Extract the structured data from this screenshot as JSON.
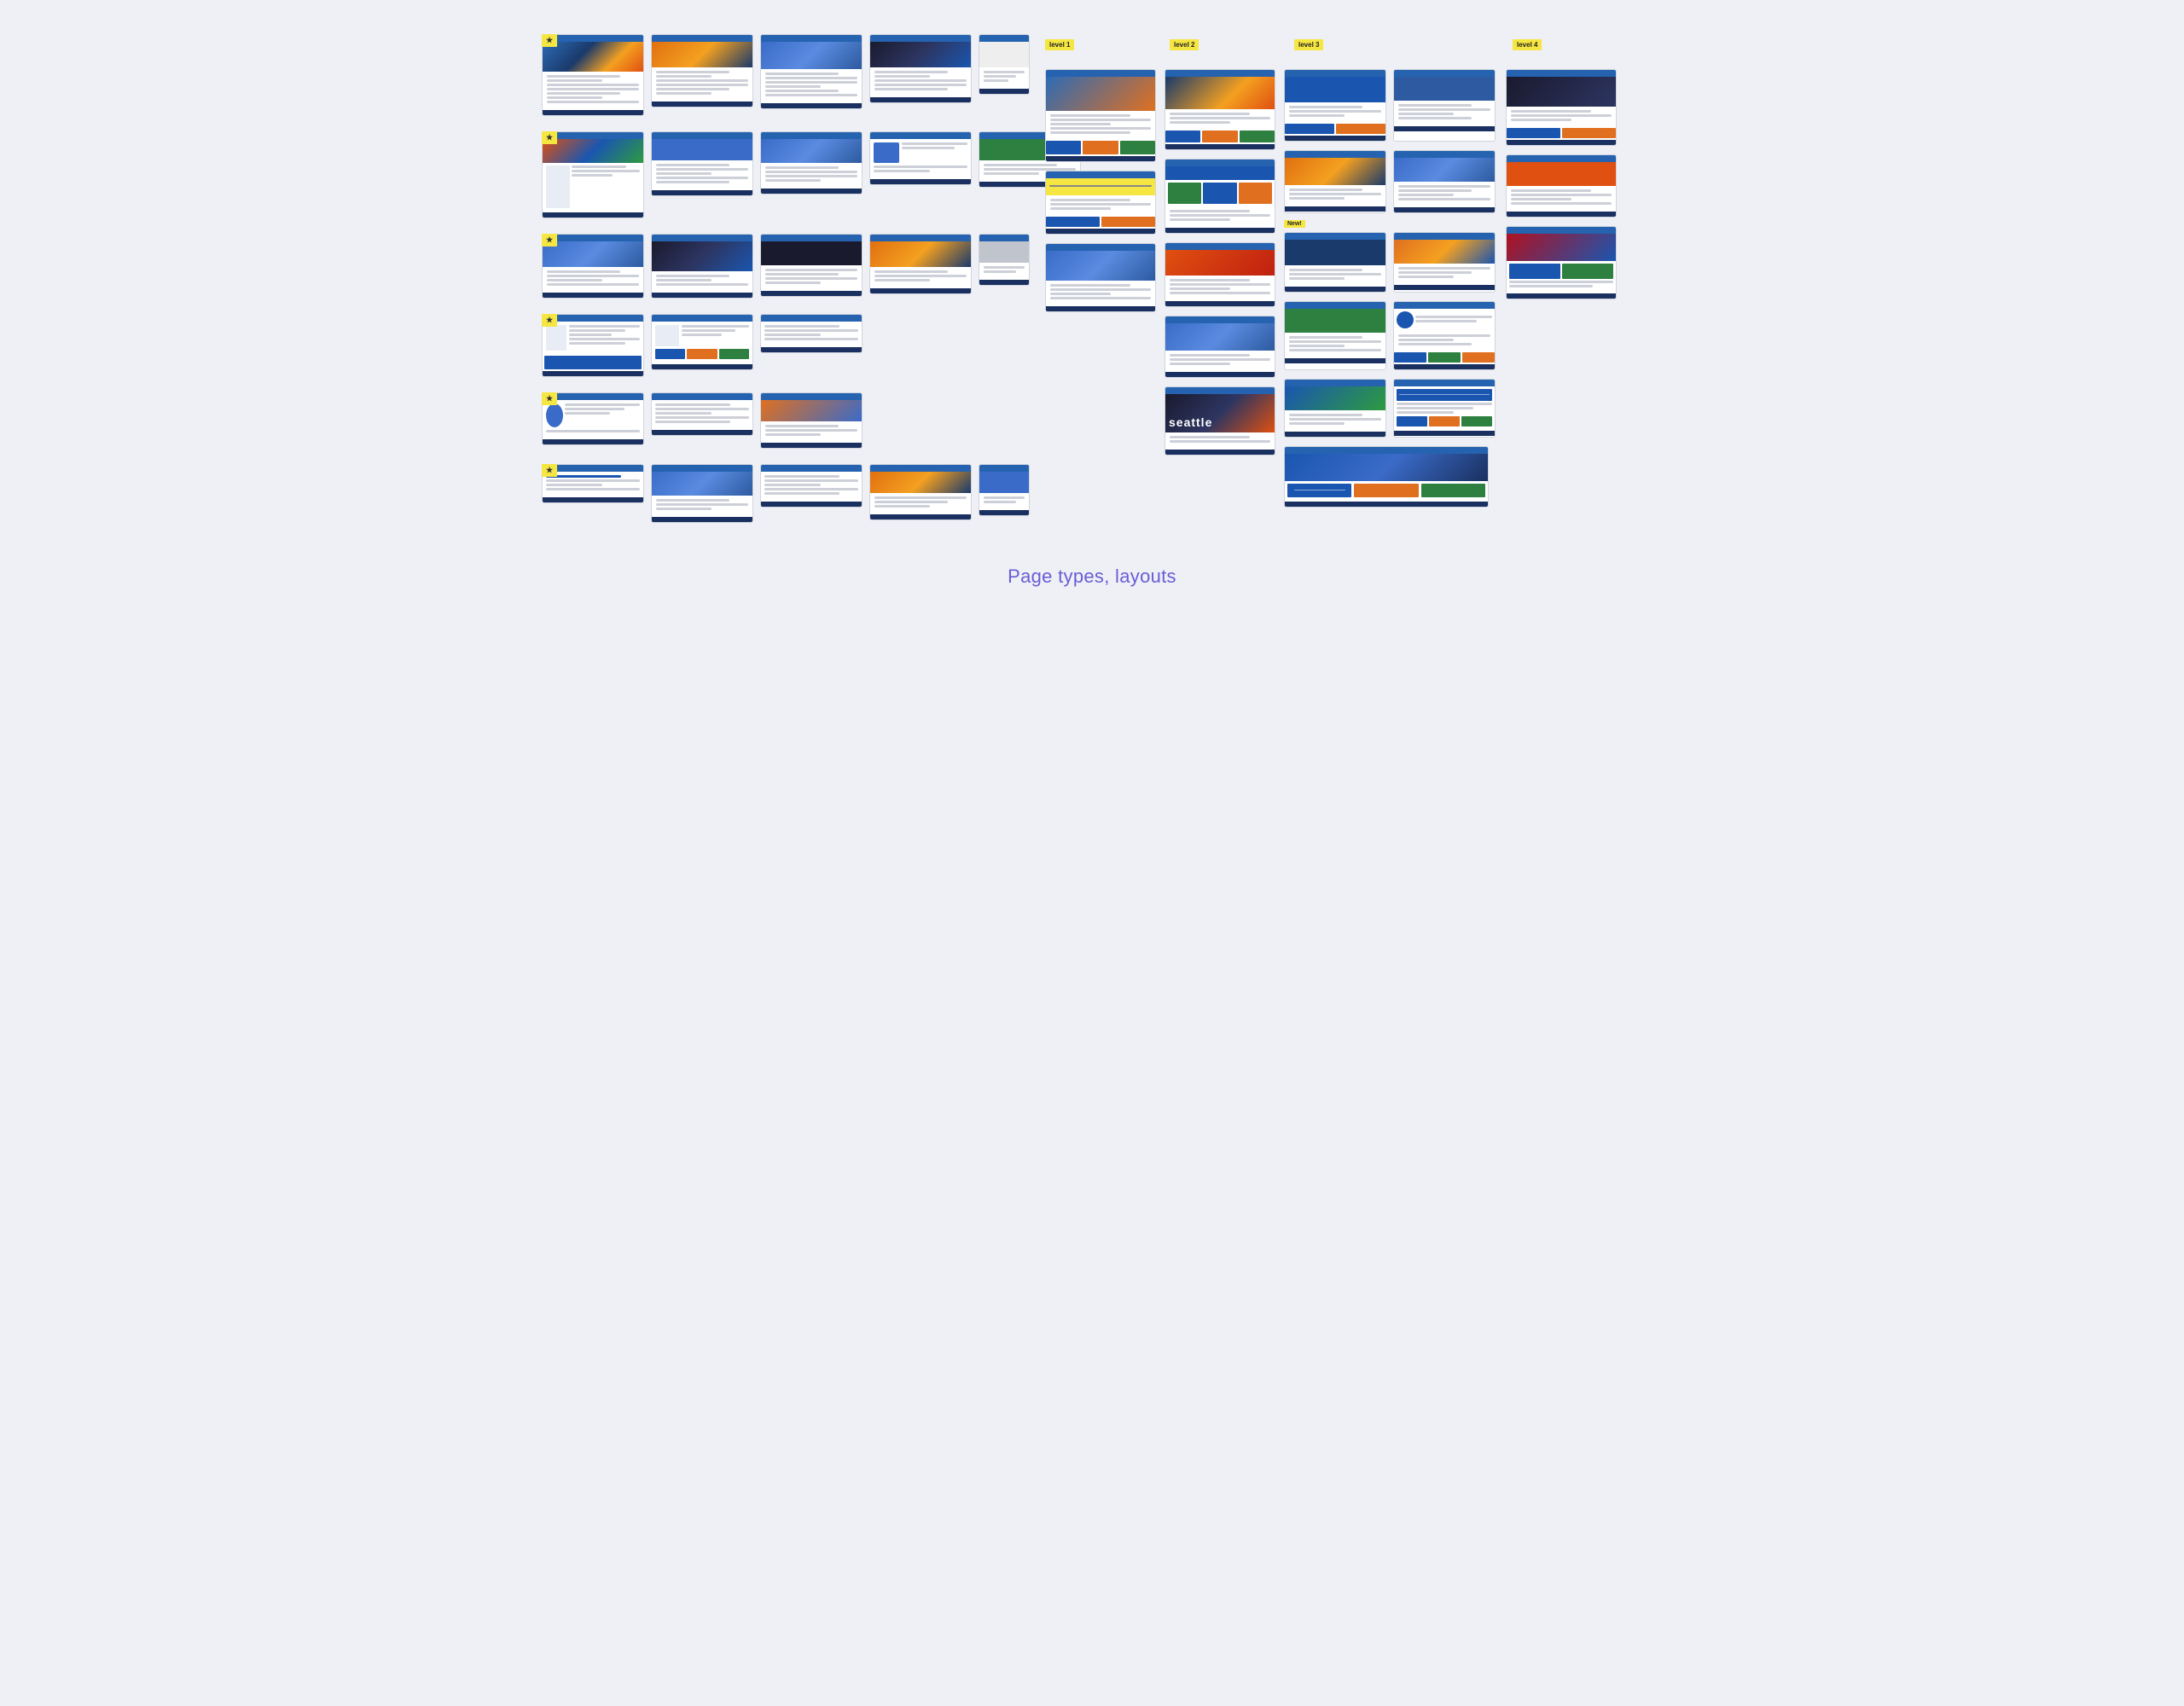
{
  "page": {
    "title": "Page types, layouts",
    "background": "#eef0f5"
  },
  "labels": {
    "group1": "level 1",
    "group2": "level 2",
    "group3": "level 3",
    "group4": "level 4",
    "sticky1": "seattle",
    "caption": "Page types, layouts"
  },
  "left_groups": [
    {
      "id": "lg1",
      "label": "",
      "screenshots": 5
    },
    {
      "id": "lg2",
      "label": "",
      "screenshots": 5
    },
    {
      "id": "lg3",
      "label": "",
      "screenshots": 5
    },
    {
      "id": "lg4",
      "label": "",
      "screenshots": 3
    },
    {
      "id": "lg5",
      "label": "",
      "screenshots": 3
    },
    {
      "id": "lg6",
      "label": "",
      "screenshots": 5
    }
  ],
  "right_groups": [
    {
      "id": "rg1",
      "label": "level 1"
    },
    {
      "id": "rg2",
      "label": "level 2"
    },
    {
      "id": "rg3",
      "label": "level 3"
    },
    {
      "id": "rg4",
      "label": "level 4"
    }
  ]
}
